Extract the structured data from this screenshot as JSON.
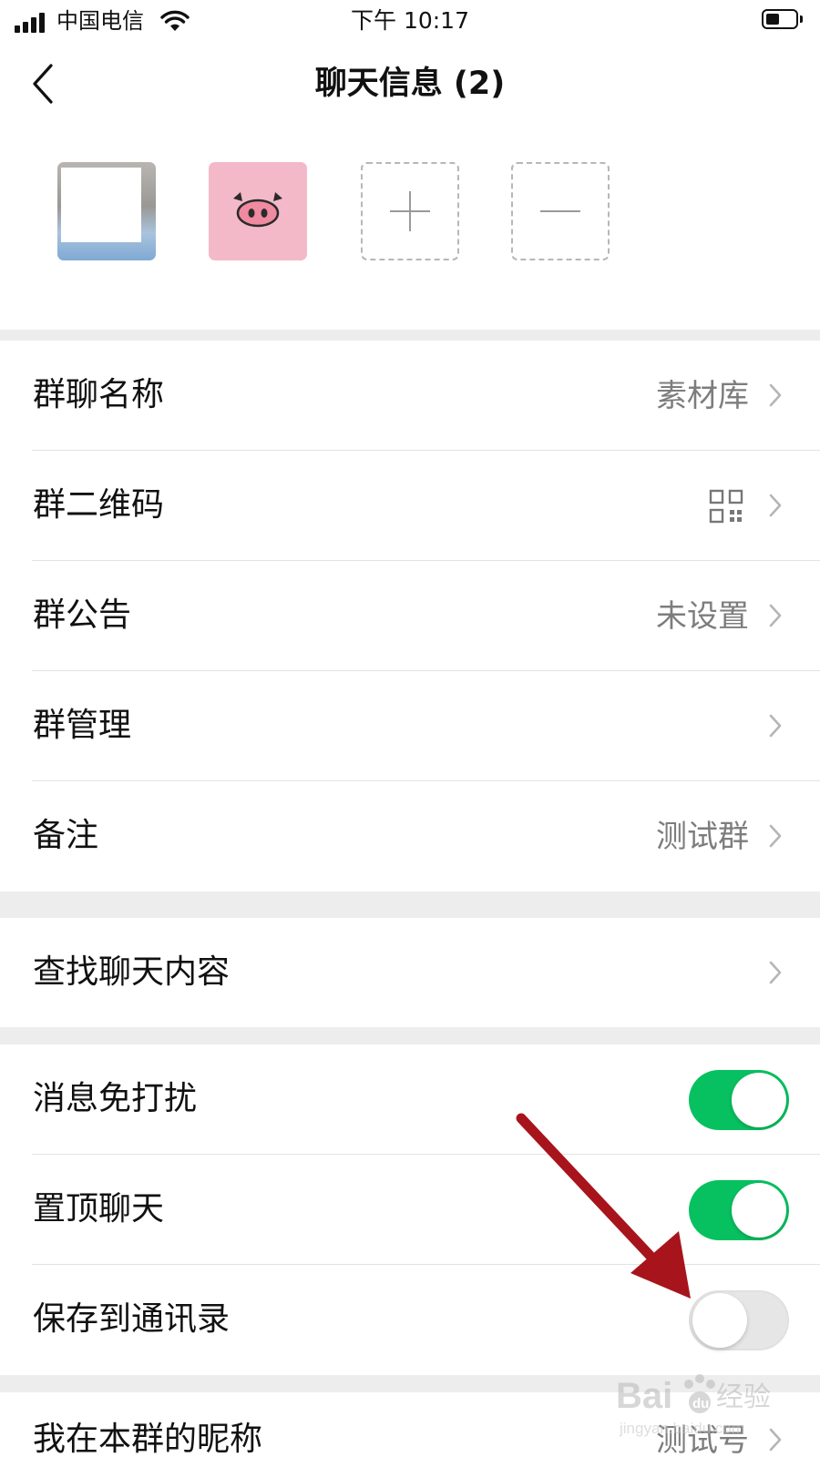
{
  "status_bar": {
    "carrier": "中国电信",
    "time": "下午 10:17",
    "battery_level": 0.45
  },
  "nav": {
    "title": "聊天信息 (2)"
  },
  "members": [
    {
      "icon": "member-avatar-photo"
    },
    {
      "icon": "pig-avatar"
    },
    {
      "icon": "plus-icon"
    },
    {
      "icon": "minus-icon"
    }
  ],
  "settings": {
    "group_name": {
      "label": "群聊名称",
      "value": "素材库"
    },
    "group_qr": {
      "label": "群二维码",
      "icon": "qr-code-icon"
    },
    "group_notice": {
      "label": "群公告",
      "value": "未设置"
    },
    "group_manage": {
      "label": "群管理"
    },
    "remark": {
      "label": "备注",
      "value": "测试群"
    },
    "search_chat": {
      "label": "查找聊天内容"
    },
    "mute": {
      "label": "消息免打扰",
      "on": true
    },
    "pin": {
      "label": "置顶聊天",
      "on": true
    },
    "save_contacts": {
      "label": "保存到通讯录",
      "on": false
    },
    "my_nickname": {
      "label": "我在本群的昵称",
      "value": "测试号"
    }
  },
  "colors": {
    "toggle_on": "#07c160",
    "toggle_off": "#e6e6e6",
    "annotation_arrow": "#a8141c",
    "page_bg": "#ededed"
  },
  "watermark": {
    "brand": "Bai",
    "brand_suffix": "du",
    "product": "经验",
    "url": "jingyan.baidu.com"
  }
}
